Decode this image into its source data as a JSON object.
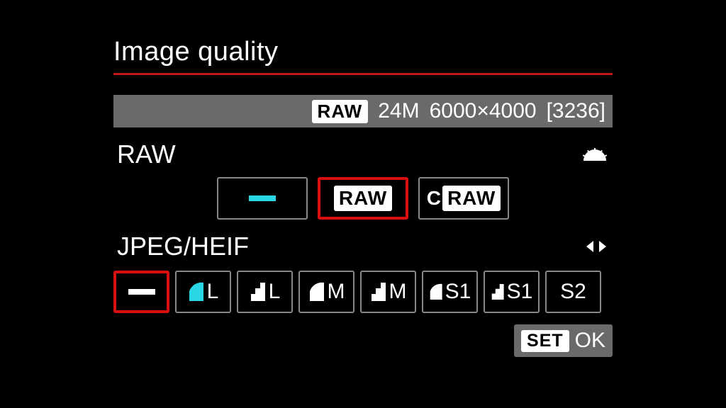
{
  "title": "Image quality",
  "info": {
    "badge": "RAW",
    "mp": "24M",
    "dims": "6000×4000",
    "shots": "[3236]"
  },
  "raw_section": {
    "label": "RAW",
    "options": {
      "none": "—",
      "raw": "RAW",
      "craw_c": "C",
      "craw_raw": "RAW"
    }
  },
  "jpeg_section": {
    "label": "JPEG/HEIF",
    "sizes": {
      "l": "L",
      "m": "M",
      "s1": "S1",
      "s2": "S2"
    }
  },
  "footer": {
    "set": "SET",
    "ok": "OK"
  }
}
